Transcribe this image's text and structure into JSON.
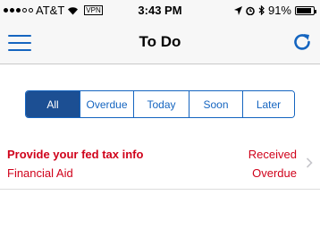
{
  "status_bar": {
    "carrier": "AT&T",
    "vpn_label": "VPN",
    "time": "3:43 PM",
    "battery_percent": "91%",
    "battery_level": 0.91,
    "signal_bars_filled": 3,
    "signal_bars_total": 5,
    "icons": [
      "signal-icon",
      "wifi-icon",
      "location-icon",
      "alarm-icon",
      "bluetooth-icon",
      "battery-icon"
    ]
  },
  "nav": {
    "title": "To Do",
    "left_icon": "menu-icon",
    "right_icon": "refresh-icon"
  },
  "filters": {
    "selected": "All",
    "options": [
      "All",
      "Overdue",
      "Today",
      "Soon",
      "Later"
    ]
  },
  "items": [
    {
      "title": "Provide your fed tax info",
      "subtitle": "Financial Aid",
      "status": "Received",
      "due": "Overdue"
    }
  ],
  "colors": {
    "accent": "#1565c0",
    "active_segment": "#1c4f93",
    "overdue": "#d0021b"
  }
}
